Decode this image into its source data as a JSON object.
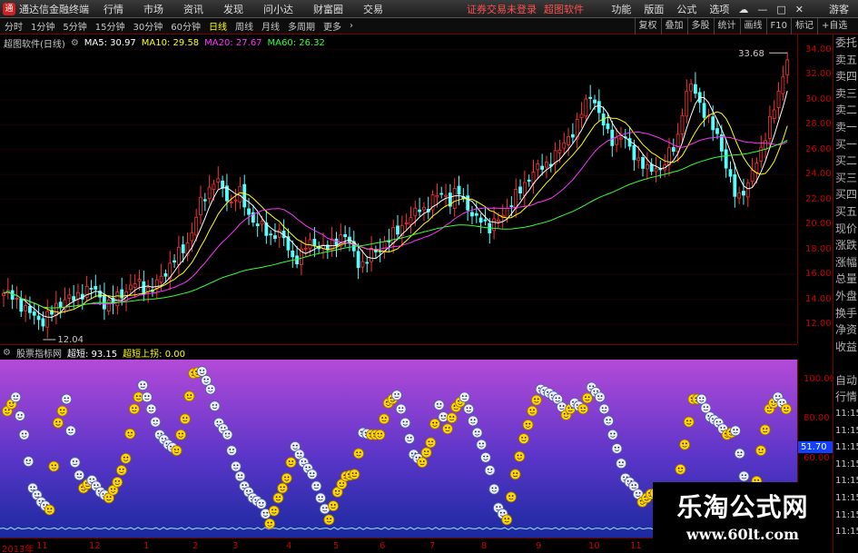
{
  "app": {
    "logo_text": "通",
    "title": "通达信金融终端",
    "menus": [
      "行情",
      "市场",
      "资讯",
      "发现",
      "问小达",
      "财富圈",
      "交易"
    ],
    "notice": "证券交易未登录",
    "brand": "超图软件",
    "right_menus": [
      "功能",
      "版面",
      "公式",
      "选项"
    ],
    "guest": "游客"
  },
  "toolbar": {
    "periods": [
      "分时",
      "1分钟",
      "5分钟",
      "15分钟",
      "30分钟",
      "60分钟",
      "日线",
      "周线",
      "月线",
      "多周期",
      "更多"
    ],
    "active_period": "日线",
    "right_buttons": [
      "复权",
      "叠加",
      "多股",
      "统计",
      "画线",
      "F10",
      "标记",
      "+自选"
    ]
  },
  "main_chart": {
    "title": "超图软件(日线)",
    "ma": [
      {
        "label": "MA5: 30.97",
        "color": "#ffffff"
      },
      {
        "label": "MA10: 29.58",
        "color": "#ffff00"
      },
      {
        "label": "MA20: 27.67",
        "color": "#ff00ff"
      },
      {
        "label": "MA60: 26.32",
        "color": "#00ff00"
      }
    ],
    "high_label": "33.68",
    "low_label": "12.04",
    "y_ticks": [
      "34.00",
      "32.00",
      "30.00",
      "28.00",
      "26.00",
      "24.00",
      "22.00",
      "20.00",
      "18.00",
      "16.00",
      "14.00",
      "12.00"
    ]
  },
  "sidebar": {
    "items": [
      "委托",
      "卖五",
      "卖四",
      "卖三",
      "卖二",
      "卖一",
      "买一",
      "买二",
      "买三",
      "买四",
      "买五",
      "现价",
      "涨跌",
      "涨幅",
      "总量",
      "外盘",
      "换手",
      "净资",
      "收益",
      "",
      "自动",
      "行情",
      "11:15",
      "11:15",
      "11:15",
      "11:15",
      "11:15",
      "11:15",
      "11:15",
      "11:15"
    ]
  },
  "indicator": {
    "name": "股票指标网",
    "v1_label": "超短: 93.15",
    "v2_label": "超短上拐: 0.00",
    "y_ticks": [
      "100.00",
      "80.00",
      "60.00",
      "40.00"
    ],
    "current": "51.70"
  },
  "time_axis": [
    "2013年",
    "11",
    "12",
    "1",
    "2",
    "3",
    "4",
    "5",
    "6",
    "7",
    "8",
    "9",
    "10",
    "11"
  ],
  "watermark": {
    "line1": "乐淘公式网",
    "line2": "www.60lt.com"
  },
  "chart_data": [
    {
      "type": "candlestick",
      "title": "超图软件(日线)",
      "ylim": [
        11,
        35
      ],
      "y_ticks": [
        12,
        14,
        16,
        18,
        20,
        22,
        24,
        26,
        28,
        30,
        32,
        34
      ],
      "annotations": [
        "33.68",
        "12.04"
      ],
      "series": [
        {
          "name": "MA5",
          "value": 30.97
        },
        {
          "name": "MA10",
          "value": 29.58
        },
        {
          "name": "MA20",
          "value": 27.67
        },
        {
          "name": "MA60",
          "value": 26.32
        }
      ],
      "close_path": [
        14.5,
        14.2,
        13.8,
        13.0,
        12.6,
        12.3,
        12.8,
        13.6,
        14.2,
        13.9,
        14.6,
        15.0,
        14.4,
        13.6,
        13.8,
        14.4,
        15.0,
        15.3,
        14.9,
        14.8,
        15.6,
        16.6,
        17.4,
        18.0,
        19.4,
        21.5,
        22.6,
        23.8,
        22.6,
        21.7,
        22.8,
        21.0,
        20.3,
        19.7,
        19.0,
        19.6,
        18.4,
        17.2,
        17.6,
        18.6,
        18.5,
        17.8,
        18.6,
        19.1,
        18.7,
        17.3,
        16.6,
        17.8,
        18.2,
        18.5,
        19.6,
        20.0,
        20.4,
        21.6,
        21.0,
        22.2,
        22.8,
        21.6,
        22.9,
        21.7,
        20.2,
        20.6,
        19.7,
        20.2,
        21.2,
        21.9,
        22.8,
        23.8,
        24.4,
        24.7,
        25.3,
        25.9,
        27.1,
        27.6,
        29.4,
        30.7,
        28.6,
        27.5,
        26.6,
        27.0,
        26.2,
        25.0,
        24.3,
        24.8,
        24.1,
        25.9,
        27.0,
        30.1,
        31.6,
        29.2,
        28.1,
        27.6,
        24.9,
        22.8,
        22.4,
        23.0,
        25.1,
        26.7,
        28.5,
        31.0,
        33.3
      ]
    },
    {
      "type": "line",
      "title": "股票指标网",
      "ylim": [
        20,
        110
      ],
      "y_ticks": [
        40,
        60,
        80,
        100
      ],
      "series": [
        {
          "name": "超短",
          "current": 93.15
        },
        {
          "name": "超短上拐",
          "current": 0
        }
      ],
      "x": [
        "2013年",
        "11",
        "12",
        "1",
        "2",
        "3",
        "4",
        "5",
        "6",
        "7",
        "8",
        "9",
        "10",
        "11"
      ],
      "values": [
        84,
        91,
        72,
        45,
        38,
        34,
        78,
        90,
        58,
        45,
        49,
        43,
        40,
        48,
        60,
        85,
        97,
        85,
        72,
        67,
        64,
        80,
        103,
        104,
        95,
        78,
        72,
        56,
        46,
        40,
        37,
        27,
        40,
        50,
        66,
        58,
        52,
        40,
        29,
        43,
        51,
        52,
        73,
        72,
        72,
        88,
        92,
        78,
        62,
        58,
        68,
        87,
        75,
        86,
        91,
        79,
        67,
        54,
        35,
        29,
        52,
        70,
        84,
        95,
        93,
        90,
        82,
        88,
        85,
        96,
        91,
        79,
        65,
        50,
        46,
        38,
        42,
        43,
        33,
        42,
        67,
        90,
        90,
        81,
        78,
        72,
        74,
        51,
        33,
        64,
        85,
        91,
        85
      ]
    }
  ]
}
